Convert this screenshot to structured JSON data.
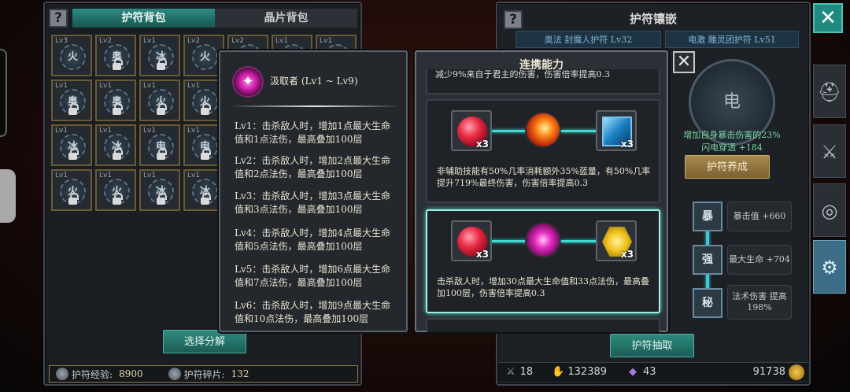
{
  "left_panel": {
    "help_icon": "?",
    "tabs": [
      "护符背包",
      "晶片背包"
    ],
    "inventory": [
      {
        "lv": "Lv3",
        "char": "火",
        "locked": false
      },
      {
        "lv": "Lv2",
        "char": "奥",
        "locked": true
      },
      {
        "lv": "Lv1",
        "char": "冰",
        "locked": true
      },
      {
        "lv": "Lv2",
        "char": "火",
        "locked": false
      },
      {
        "lv": "Lv2",
        "char": "",
        "locked": false
      },
      {
        "lv": "Lv1",
        "char": "",
        "locked": false
      },
      {
        "lv": "Lv1",
        "char": "",
        "locked": false
      },
      {
        "lv": "Lv1",
        "char": "奥",
        "locked": true
      },
      {
        "lv": "Lv1",
        "char": "奥",
        "locked": true
      },
      {
        "lv": "Lv1",
        "char": "火",
        "locked": true
      },
      {
        "lv": "Lv1",
        "char": "火",
        "locked": true
      },
      {
        "lv": "",
        "char": "",
        "locked": false
      },
      {
        "lv": "",
        "char": "",
        "locked": false
      },
      {
        "lv": "",
        "char": "",
        "locked": false
      },
      {
        "lv": "Lv1",
        "char": "冰",
        "locked": true
      },
      {
        "lv": "Lv1",
        "char": "冰",
        "locked": true
      },
      {
        "lv": "Lv1",
        "char": "电",
        "locked": true
      },
      {
        "lv": "Lv1",
        "char": "电",
        "locked": true
      },
      {
        "lv": "",
        "char": "",
        "locked": false
      },
      {
        "lv": "",
        "char": "",
        "locked": false
      },
      {
        "lv": "",
        "char": "",
        "locked": false
      },
      {
        "lv": "Lv1",
        "char": "火",
        "locked": true
      },
      {
        "lv": "Lv1",
        "char": "火",
        "locked": true
      },
      {
        "lv": "Lv1",
        "char": "冰",
        "locked": true
      },
      {
        "lv": "Lv1",
        "char": "冰",
        "locked": true
      },
      {
        "lv": "",
        "char": "",
        "locked": false
      },
      {
        "lv": "",
        "char": "",
        "locked": false
      },
      {
        "lv": "",
        "char": "",
        "locked": false
      }
    ],
    "decompose_button": "选择分解",
    "exp_label": "护符经验:",
    "exp_value": "8900",
    "shard_label": "护符碎片:",
    "shard_value": "132"
  },
  "right_panel": {
    "title": "护符镶嵌",
    "amulet_left": "奥法 封魔人护符 Lv32",
    "amulet_right": "电激 雕灵团护符 Lv51",
    "emblem_char": "电",
    "effect_line1": "增加自身暴击伤害的23%",
    "effect_line2": "闪电穿透 +184",
    "cultivate_button": "护符养成",
    "runes": [
      {
        "char": "暴",
        "attr": "暴击值 +660"
      },
      {
        "char": "强",
        "attr": "最大生命 +704"
      },
      {
        "char": "秘",
        "attr": "法术伤害 提高 198%"
      }
    ],
    "extract_button": "护符抽取",
    "stats": {
      "kills": "18",
      "gold_a": "132389",
      "gems": "43",
      "coins": "91738"
    }
  },
  "side_buttons": {
    "close": "✕",
    "icons": [
      "helmet-icon",
      "swords-icon",
      "target-icon",
      "gear-icon"
    ]
  },
  "skill_popup": {
    "title": "汲取者 (Lv1 ~ Lv9)",
    "levels": [
      "Lv1：击杀敌人时，增加1点最大生命值和1点法伤，最高叠加100层",
      "Lv2：击杀敌人时，增加2点最大生命值和2点法伤，最高叠加100层",
      "Lv3：击杀敌人时，增加3点最大生命值和3点法伤，最高叠加100层",
      "Lv4：击杀敌人时，增加4点最大生命值和5点法伤，最高叠加100层",
      "Lv5：击杀敌人时，增加6点最大生命值和7点法伤，最高叠加100层",
      "Lv6：击杀敌人时，增加9点最大生命值和10点法伤，最高叠加100层"
    ]
  },
  "combo_popup": {
    "title": "连携能力",
    "close": "✕",
    "top_cut_text": "减少9%来自于君主的伤害，伤害倍率提高0.3",
    "combos": [
      {
        "left_count": "x3",
        "right_count": "x3",
        "desc": "非辅助技能有50%几率消耗额外35%蓝量，有50%几率提升719%最终伤害，伤害倍率提高0.3"
      },
      {
        "left_count": "x3",
        "right_count": "x3",
        "desc": "击杀敌人时，增加30点最大生命值和33点法伤，最高叠加100层，伤害倍率提高0.3"
      }
    ]
  }
}
